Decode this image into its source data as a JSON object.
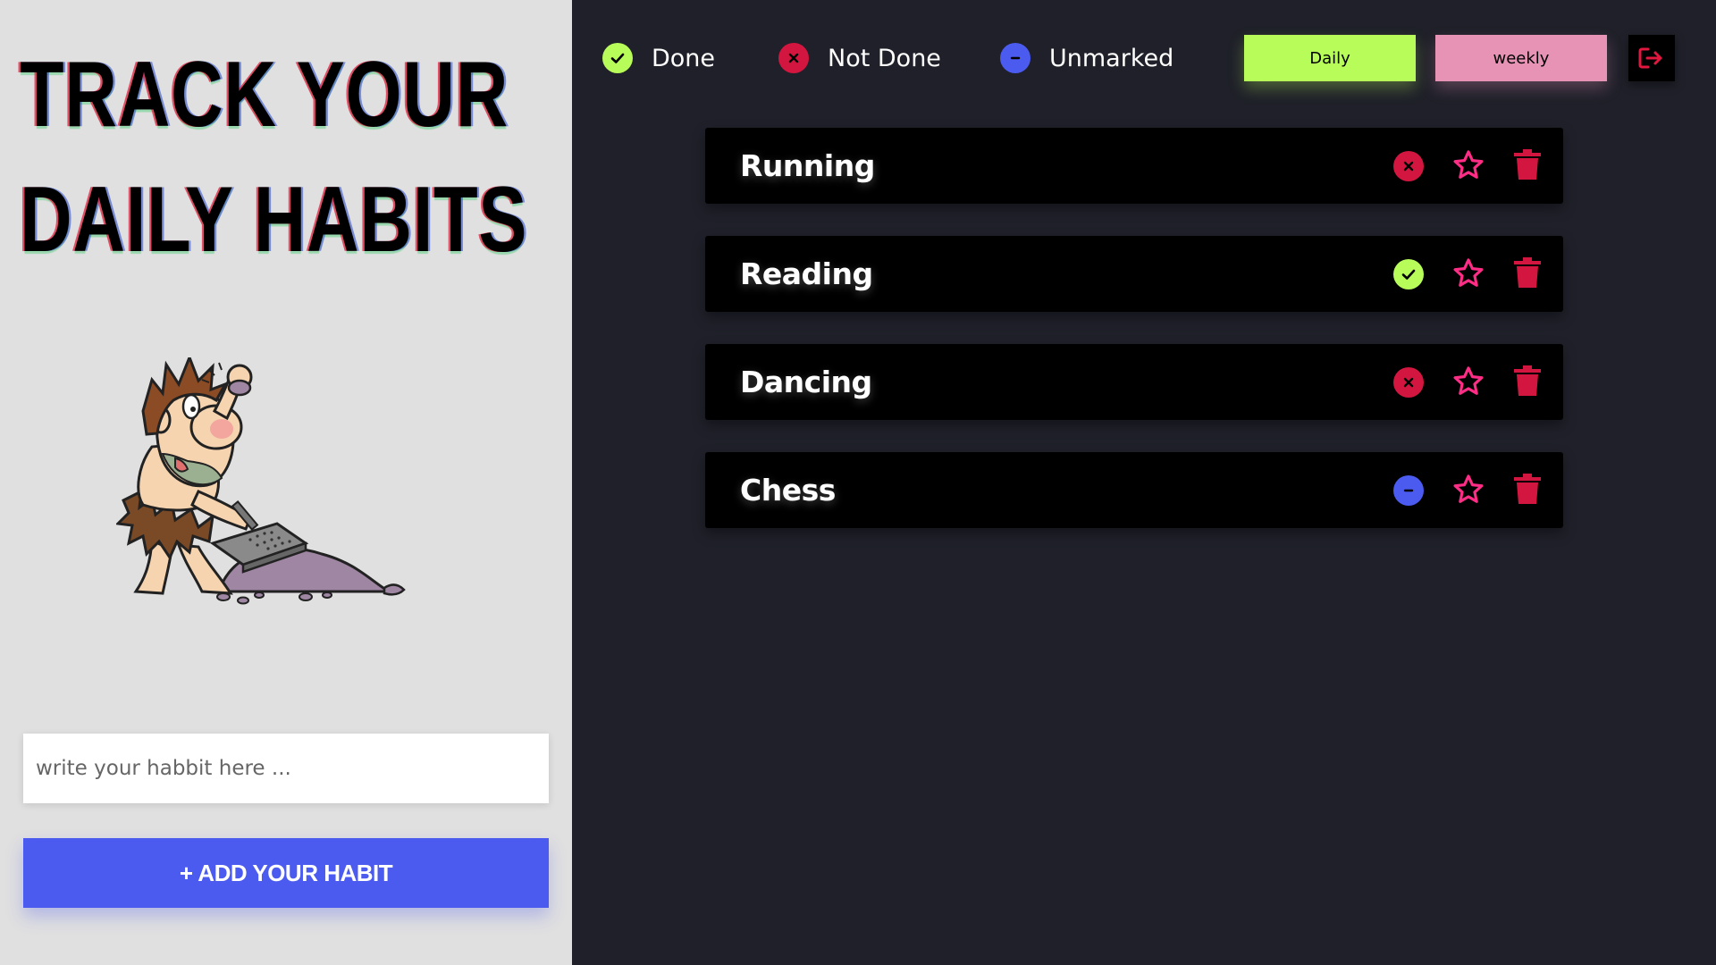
{
  "headline": {
    "line1": "TRACK YOUR",
    "line2": "DAILY  HABITS"
  },
  "form": {
    "input_placeholder": "write your habbit here ...",
    "input_value": "",
    "add_button_label": "+ ADD YOUR HABIT"
  },
  "legend": [
    {
      "label": "Done",
      "icon": "check-circle-icon",
      "color": "#b8fc5a"
    },
    {
      "label": "Not Done",
      "icon": "x-circle-icon",
      "color": "#d3163f"
    },
    {
      "label": "Unmarked",
      "icon": "minus-circle-icon",
      "color": "#4b5bf0"
    }
  ],
  "view_toggle": {
    "daily_label": "Daily",
    "weekly_label": "weekly",
    "daily_color": "#b8fc5a",
    "weekly_color": "#e693b6"
  },
  "logout": {
    "icon": "logout-icon",
    "color": "#e0173f"
  },
  "habits": [
    {
      "name": "Running",
      "status": "not-done",
      "favorite": false
    },
    {
      "name": "Reading",
      "status": "done",
      "favorite": false
    },
    {
      "name": "Dancing",
      "status": "not-done",
      "favorite": false
    },
    {
      "name": "Chess",
      "status": "unmarked",
      "favorite": false
    }
  ],
  "colors": {
    "left_panel_bg": "#e0e0e0",
    "right_panel_bg": "#1f2029",
    "card_bg": "#000000",
    "star": "#ff2d86",
    "trash": "#d3163f",
    "add_button": "#4b5bf0"
  }
}
